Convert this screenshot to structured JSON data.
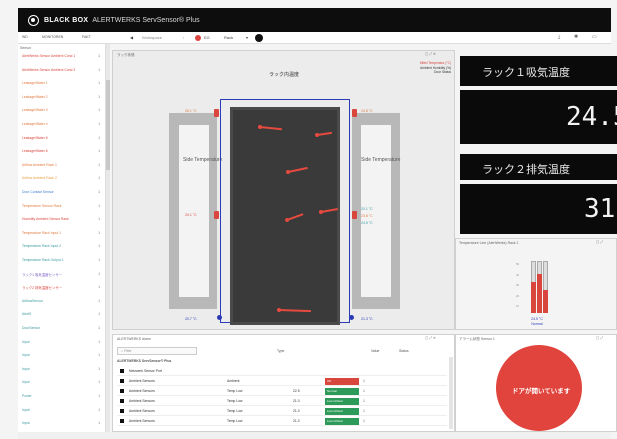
{
  "topbar": {
    "brand": "BLACK BOX",
    "product": "ALERTWERKS ServSensor® Plus"
  },
  "toolbar": {
    "menu_tabs": [
      "WD",
      "MONITOREN",
      "FAKT"
    ],
    "breadcrumb": "Workspace",
    "status_count": "EG",
    "rack_selector": "Rack",
    "right_icons": [
      "download-icon",
      "gear-icon",
      "window-icon"
    ]
  },
  "sidebar": {
    "header": "Sensor",
    "items": [
      {
        "label": "AlertWerks Sensor Ambient Cond 1",
        "count": "1",
        "color": "#d9463e"
      },
      {
        "label": "AlertWerks Sensor Ambient Cond 2",
        "count": "1",
        "color": "#d9463e"
      },
      {
        "label": "Leakage/Water 1",
        "count": "1",
        "color": "#e07a40"
      },
      {
        "label": "Leakage/Water 2",
        "count": "1",
        "color": "#e07a40"
      },
      {
        "label": "Leakage/Water 3",
        "count": "1",
        "color": "#e07a40"
      },
      {
        "label": "Leakage/Water 4",
        "count": "1",
        "color": "#e07a40"
      },
      {
        "label": "Leakage/Water 5",
        "count": "1",
        "color": "#d9463e"
      },
      {
        "label": "Leakage/Water 6",
        "count": "1",
        "color": "#d9463e"
      },
      {
        "label": "Airflow Ambient Rack 1",
        "count": "1",
        "color": "#e07a40"
      },
      {
        "label": "Airflow Ambient Rack 2",
        "count": "1",
        "color": "#e8a040"
      },
      {
        "label": "Door Contact Sensor",
        "count": "1",
        "color": "#3b7fd0"
      },
      {
        "label": "Temperature Sensor Rack",
        "count": "1",
        "color": "#e07a40"
      },
      {
        "label": "Humidity Ambient Sensor Rack",
        "count": "1",
        "color": "#d9463e"
      },
      {
        "label": "Temperature Rack Input 1",
        "count": "1",
        "color": "#e07a40"
      },
      {
        "label": "Temperature Rack Input 2",
        "count": "1",
        "color": "#3b9aa0"
      },
      {
        "label": "Temperature Rack Output 1",
        "count": "1",
        "color": "#3b9aa0"
      },
      {
        "label": "ラック1 吸気温度センサー",
        "count": "1",
        "color": "#7a5fc0"
      },
      {
        "label": "ラック2 排気温度センサー",
        "count": "1",
        "color": "#d9463e"
      },
      {
        "label": "AirflowSensor",
        "count": "1",
        "color": "#3b9aa0"
      },
      {
        "label": "AlertS",
        "count": "1",
        "color": "#3b9aa0"
      },
      {
        "label": "DoorSensor",
        "count": "1",
        "color": "#3b9aa0"
      },
      {
        "label": "Input",
        "count": "1",
        "color": "#3b9aa0"
      },
      {
        "label": "Input",
        "count": "1",
        "color": "#3b9aa0"
      },
      {
        "label": "Input",
        "count": "1",
        "color": "#3b9aa0"
      },
      {
        "label": "Input",
        "count": "1",
        "color": "#3b9aa0"
      },
      {
        "label": "Power",
        "count": "1",
        "color": "#3b9aa0"
      },
      {
        "label": "Input",
        "count": "1",
        "color": "#3b9aa0"
      },
      {
        "label": "Input",
        "count": "1",
        "color": "#3b9aa0"
      }
    ]
  },
  "rack_panel": {
    "header": "ラック状態",
    "title": "ラック内温度",
    "info_lines": [
      "Mittel Temperatur (°C)",
      "Ambient Humidity (%)",
      "Door Status"
    ],
    "door_left_label": "Side Temperature",
    "door_right_label": "Side Temperature",
    "sensor_labels": [
      {
        "text": "26.1 °C",
        "color": "#e07a40"
      },
      {
        "text": "24.8 °C",
        "color": "#e07a40"
      },
      {
        "text": "20.1 °C",
        "color": "#d9463e"
      },
      {
        "text": "20.1 °C",
        "color": "#3b9aa0"
      },
      {
        "text": "23.8 °C",
        "color": "#e07a40"
      },
      {
        "text": "24.5 °C",
        "color": "#3b9aa0"
      },
      {
        "text": "20.7 °C",
        "color": "#2b3bb6"
      },
      {
        "text": "21.3 °C",
        "color": "#2b3bb6"
      }
    ]
  },
  "temp_displays": [
    {
      "label": "ラック１吸気温度",
      "value": "24.5"
    },
    {
      "label": "ラック２排気温度",
      "value": "31."
    }
  ],
  "gauge_panel": {
    "header": "Temperature Line (AlertWerks) Rack 1",
    "reading": "24.5 °C",
    "status": "Normal",
    "levels": [
      0.6,
      0.75,
      0.45
    ],
    "scale": [
      "50",
      "40",
      "30",
      "20",
      "10"
    ]
  },
  "alarm_panel": {
    "header": "アラーム状態 Sensor 1",
    "message": "ドアが開いています"
  },
  "table": {
    "header": "ALERTWERKS Alarm",
    "search_placeholder": "Filter",
    "columns": [
      "Name",
      "Type",
      "Value",
      "Status"
    ],
    "group_title": "ALERTWERKS ServSensor® Plus",
    "rows": [
      {
        "name": "Netzwerk Sensor Port",
        "type": "",
        "value": "",
        "status": "",
        "status_color": "",
        "num": ""
      },
      {
        "name": "Ambient Sensors",
        "type": "Ambient",
        "value": "",
        "status": "OK",
        "status_color": "#d9463e",
        "num": "1"
      },
      {
        "name": "Ambient Sensors",
        "type": "Temp Low",
        "value": "22.5",
        "status": "Normal",
        "status_color": "#2e9a5a",
        "num": "1"
      },
      {
        "name": "Ambient Sensors",
        "type": "Temp Low",
        "value": "21.0",
        "status": "Low Critical",
        "status_color": "#2e9a5a",
        "num": "1"
      },
      {
        "name": "Ambient Sensors",
        "type": "Temp Low",
        "value": "21.0",
        "status": "Low Critical",
        "status_color": "#2e9a5a",
        "num": "1"
      },
      {
        "name": "Ambient Sensors",
        "type": "Temp Low",
        "value": "21.0",
        "status": "Low Critical",
        "status_color": "#2e9a5a",
        "num": "1"
      }
    ]
  },
  "colors": {
    "accent_red": "#d9463e",
    "rack_blue": "#2b3bb6",
    "status_green": "#2e9a5a"
  }
}
